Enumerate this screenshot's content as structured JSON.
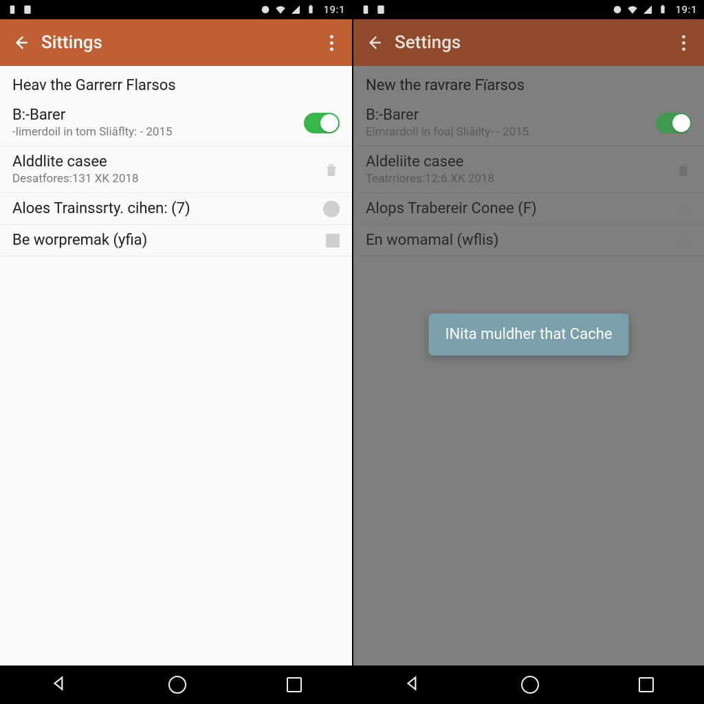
{
  "left": {
    "status": {
      "time": "19:1"
    },
    "appbar": {
      "title": "Sittings"
    },
    "section_header": "Heav the Garrerr Flarsos",
    "rows": [
      {
        "title": "B:-Barer",
        "sub": "-limerdoil in tom Sliâflty: - 2015",
        "control": "toggle_on"
      },
      {
        "title": "Alddlite casee",
        "sub": "Desatfores:131 XK 2018",
        "control": "trash"
      },
      {
        "title": "Aloes Trainssrty. cihen: (7)",
        "sub": "",
        "control": "radio_off"
      },
      {
        "title": "Be worpremak (yfia)",
        "sub": "",
        "control": "checkbox_off"
      }
    ]
  },
  "right": {
    "status": {
      "time": "19:1"
    },
    "appbar": {
      "title": "Settings"
    },
    "section_header": "New the ravrare Fïarsos",
    "rows": [
      {
        "title": "B:-Barer",
        "sub": "Elmrardoli in foa| Sliâilty- - 2015",
        "control": "toggle_on"
      },
      {
        "title": "Aldeliite casee",
        "sub": "Teatrriores:12:6.XK 2018",
        "control": "trash"
      },
      {
        "title": "Alops Trabereir Conee (F)",
        "sub": "",
        "control": "radio_off"
      },
      {
        "title": "En womamal (wflis)",
        "sub": "",
        "control": "checkbox_off"
      }
    ],
    "toast": "INita muldher that Cache"
  }
}
